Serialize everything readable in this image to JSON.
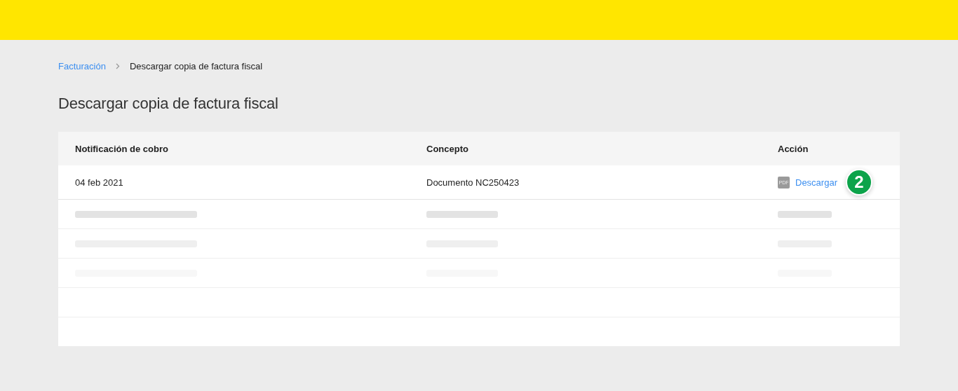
{
  "breadcrumb": [
    {
      "label": "Facturación",
      "kind": "link"
    },
    {
      "label": "Descargar copia de factura fiscal",
      "kind": "current"
    }
  ],
  "title": "Descargar copia de factura fiscal",
  "table": {
    "columns": [
      "Notificación de cobro",
      "Concepto",
      "Acción"
    ],
    "rows": [
      {
        "kind": "data",
        "cells": [
          "04 feb 2021",
          "Documento NC250423"
        ],
        "action": {
          "icon_text": "PDF",
          "label": "Descargar"
        },
        "step_badge": "2"
      },
      {
        "kind": "skeleton",
        "color": "#e3e3e3"
      },
      {
        "kind": "skeleton",
        "color": "#efefef"
      },
      {
        "kind": "skeleton",
        "color": "#f7f7f7"
      },
      {
        "kind": "empty"
      },
      {
        "kind": "empty"
      }
    ]
  }
}
